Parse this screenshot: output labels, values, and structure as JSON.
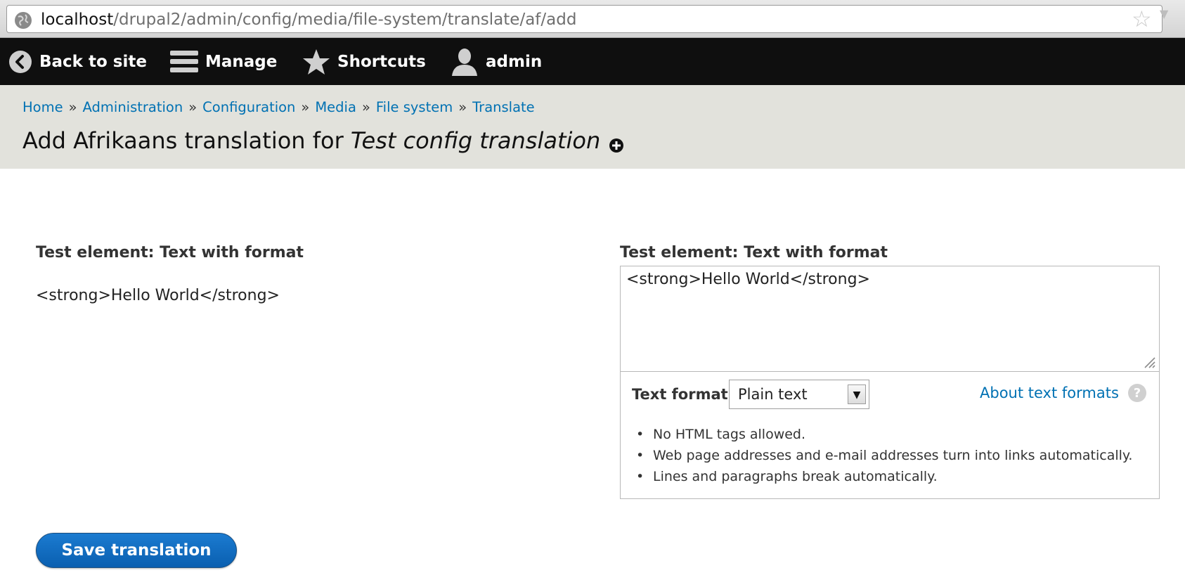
{
  "browser": {
    "url_host": "localhost",
    "url_path": "/drupal2/admin/config/media/file-system/translate/af/add",
    "star_icon": "bookmark-star-icon"
  },
  "toolbar": {
    "back_label": "Back to site",
    "manage_label": "Manage",
    "shortcuts_label": "Shortcuts",
    "user_label": "admin"
  },
  "breadcrumb": {
    "items": [
      "Home",
      "Administration",
      "Configuration",
      "Media",
      "File system",
      "Translate"
    ],
    "separator": "»"
  },
  "page": {
    "title_prefix": "Add Afrikaans translation for ",
    "title_name": "Test config translation"
  },
  "source": {
    "label": "Test element: Text with format",
    "value": "<strong>Hello World</strong>"
  },
  "target": {
    "label": "Test element: Text with format",
    "value": "<strong>Hello World</strong>",
    "text_format_label": "Text format",
    "text_format_selected": "Plain text",
    "about_link": "About text formats",
    "tips": [
      "No HTML tags allowed.",
      "Web page addresses and e-mail addresses turn into links automatically.",
      "Lines and paragraphs break automatically."
    ]
  },
  "actions": {
    "save_label": "Save translation"
  },
  "colors": {
    "link": "#0071b3",
    "toolbar_bg": "#0f0f0f",
    "header_bg": "#e2e2dc",
    "button": "#0a6fc2"
  }
}
